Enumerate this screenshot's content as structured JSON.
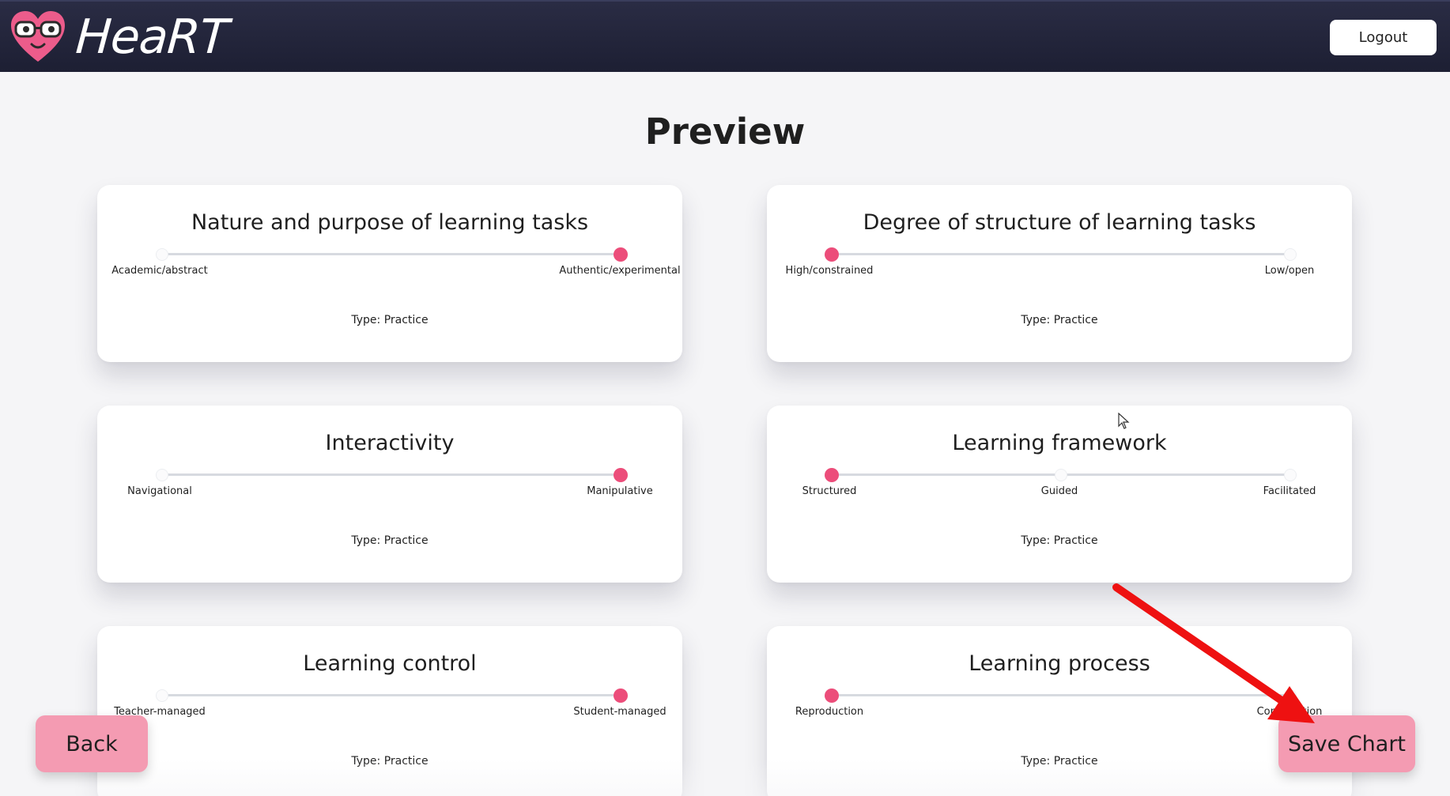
{
  "app": {
    "name": "HeaRT"
  },
  "navbar": {
    "logout_label": "Logout"
  },
  "page": {
    "title": "Preview"
  },
  "cards": [
    {
      "title": "Nature and purpose of learning tasks",
      "labels": [
        "Academic/abstract",
        "Authentic/experimental"
      ],
      "selected_index": 1,
      "type": "Type: Practice"
    },
    {
      "title": "Degree of structure of learning tasks",
      "labels": [
        "High/constrained",
        "Low/open"
      ],
      "selected_index": 0,
      "type": "Type: Practice"
    },
    {
      "title": "Interactivity",
      "labels": [
        "Navigational",
        "Manipulative"
      ],
      "selected_index": 1,
      "type": "Type: Practice"
    },
    {
      "title": "Learning framework",
      "labels": [
        "Structured",
        "Guided",
        "Facilitated"
      ],
      "selected_index": 0,
      "type": "Type: Practice"
    },
    {
      "title": "Learning control",
      "labels": [
        "Teacher-managed",
        "Student-managed"
      ],
      "selected_index": 1,
      "type": "Type: Practice"
    },
    {
      "title": "Learning process",
      "labels": [
        "Reproduction",
        "Construction"
      ],
      "selected_index": 0,
      "type": "Type: Practice"
    }
  ],
  "footer": {
    "back_label": "Back",
    "save_label": "Save Chart"
  },
  "colors": {
    "navbar": "#1d1f33",
    "accent": "#ec4d7a",
    "button": "#f49bb2",
    "annotation_arrow": "#ee1111"
  },
  "icons": {
    "logo": "heart-with-glasses-icon",
    "cursor": "mouse-pointer-icon",
    "annotation": "red-arrow-icon"
  }
}
